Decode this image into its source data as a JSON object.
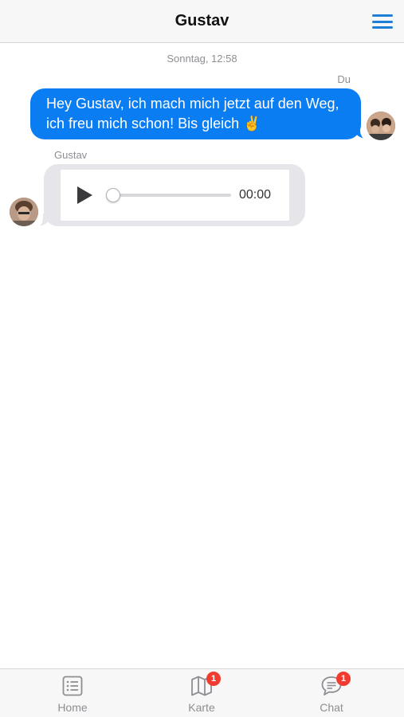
{
  "header": {
    "title": "Gustav",
    "menu_icon": "hamburger-menu-icon",
    "accent_color": "#1e7fd8"
  },
  "conversation": {
    "timestamp": "Sonntag, 12:58",
    "messages": [
      {
        "sender": "Du",
        "direction": "outgoing",
        "text": "Hey Gustav, ich mach mich jetzt auf den Weg, ich freu mich schon! Bis gleich ✌️",
        "bubble_color": "#0a7df2"
      },
      {
        "sender": "Gustav",
        "direction": "incoming",
        "type": "audio",
        "audio_time": "00:00",
        "progress": 0,
        "bubble_color": "#e6e6ea"
      }
    ]
  },
  "tabbar": {
    "tabs": [
      {
        "label": "Home",
        "icon": "list-icon",
        "badge": ""
      },
      {
        "label": "Karte",
        "icon": "map-icon",
        "badge": "1"
      },
      {
        "label": "Chat",
        "icon": "chat-bubble-icon",
        "badge": "1"
      }
    ],
    "badge_color": "#f23b30"
  }
}
